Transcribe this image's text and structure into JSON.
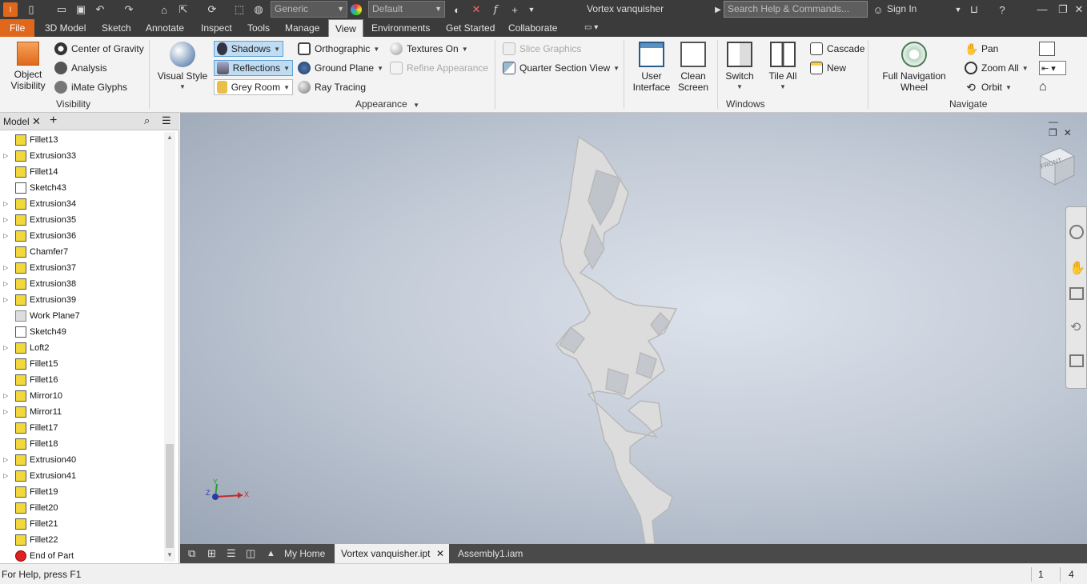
{
  "titlebar": {
    "title": "Vortex vanquisher",
    "material_combo": "Generic",
    "appearance_combo": "Default",
    "search_placeholder": "Search Help & Commands...",
    "sign_in": "Sign In"
  },
  "menu": {
    "file": "File",
    "tabs": [
      "3D Model",
      "Sketch",
      "Annotate",
      "Inspect",
      "Tools",
      "Manage",
      "View",
      "Environments",
      "Get Started",
      "Collaborate"
    ],
    "active": "View"
  },
  "ribbon": {
    "visibility": {
      "title": "Visibility",
      "object_visibility": [
        "Object",
        "Visibility"
      ],
      "center_of_gravity": "Center of Gravity",
      "analysis": "Analysis",
      "imate_glyphs": "iMate Glyphs"
    },
    "appearance": {
      "title": "Appearance",
      "visual_style": "Visual Style",
      "shadows": "Shadows",
      "reflections": "Reflections",
      "grey_room": "Grey Room",
      "orthographic": "Orthographic",
      "ground_plane": "Ground Plane",
      "ray_tracing": "Ray Tracing",
      "textures_on": "Textures On",
      "refine_appearance": "Refine Appearance",
      "slice_graphics": "Slice Graphics",
      "quarter_section_view": "Quarter Section View"
    },
    "windows": {
      "title": "Windows",
      "user_interface": [
        "User",
        "Interface"
      ],
      "clean_screen": [
        "Clean",
        "Screen"
      ],
      "switch": "Switch",
      "tile_all": "Tile All",
      "cascade": "Cascade",
      "new": "New"
    },
    "navigate": {
      "title": "Navigate",
      "full_nav_wheel": [
        "Full Navigation",
        "Wheel"
      ],
      "pan": "Pan",
      "zoom_all": "Zoom All",
      "orbit": "Orbit"
    }
  },
  "browser": {
    "tab": "Model",
    "items": [
      {
        "label": "Fillet13",
        "type": "feature",
        "expandable": false
      },
      {
        "label": "Extrusion33",
        "type": "feature",
        "expandable": true
      },
      {
        "label": "Fillet14",
        "type": "feature",
        "expandable": false
      },
      {
        "label": "Sketch43",
        "type": "sketch",
        "expandable": false
      },
      {
        "label": "Extrusion34",
        "type": "feature",
        "expandable": true
      },
      {
        "label": "Extrusion35",
        "type": "feature",
        "expandable": true
      },
      {
        "label": "Extrusion36",
        "type": "feature",
        "expandable": true
      },
      {
        "label": "Chamfer7",
        "type": "feature",
        "expandable": false
      },
      {
        "label": "Extrusion37",
        "type": "feature",
        "expandable": true
      },
      {
        "label": "Extrusion38",
        "type": "feature",
        "expandable": true
      },
      {
        "label": "Extrusion39",
        "type": "feature",
        "expandable": true
      },
      {
        "label": "Work Plane7",
        "type": "workplane",
        "expandable": false
      },
      {
        "label": "Sketch49",
        "type": "sketch",
        "expandable": false
      },
      {
        "label": "Loft2",
        "type": "feature",
        "expandable": true
      },
      {
        "label": "Fillet15",
        "type": "feature",
        "expandable": false
      },
      {
        "label": "Fillet16",
        "type": "feature",
        "expandable": false
      },
      {
        "label": "Mirror10",
        "type": "feature",
        "expandable": true
      },
      {
        "label": "Mirror11",
        "type": "feature",
        "expandable": true
      },
      {
        "label": "Fillet17",
        "type": "feature",
        "expandable": false
      },
      {
        "label": "Fillet18",
        "type": "feature",
        "expandable": false
      },
      {
        "label": "Extrusion40",
        "type": "feature",
        "expandable": true
      },
      {
        "label": "Extrusion41",
        "type": "feature",
        "expandable": true
      },
      {
        "label": "Fillet19",
        "type": "feature",
        "expandable": false
      },
      {
        "label": "Fillet20",
        "type": "feature",
        "expandable": false
      },
      {
        "label": "Fillet21",
        "type": "feature",
        "expandable": false
      },
      {
        "label": "Fillet22",
        "type": "feature",
        "expandable": false
      },
      {
        "label": "End of Part",
        "type": "end",
        "expandable": false
      }
    ]
  },
  "viewcube": {
    "face": "FRONT"
  },
  "triad": {
    "x": "X",
    "y": "Y",
    "z": "Z"
  },
  "doc_tabs": {
    "home": "My Home",
    "active": "Vortex vanquisher.ipt",
    "other": "Assembly1.iam"
  },
  "status": {
    "help": "For Help, press F1",
    "count1": "1",
    "count2": "4"
  },
  "colors": {
    "file_tab": "#e0681c",
    "accent": "#5ea1d6",
    "dark_chrome": "#3b3b3b"
  }
}
